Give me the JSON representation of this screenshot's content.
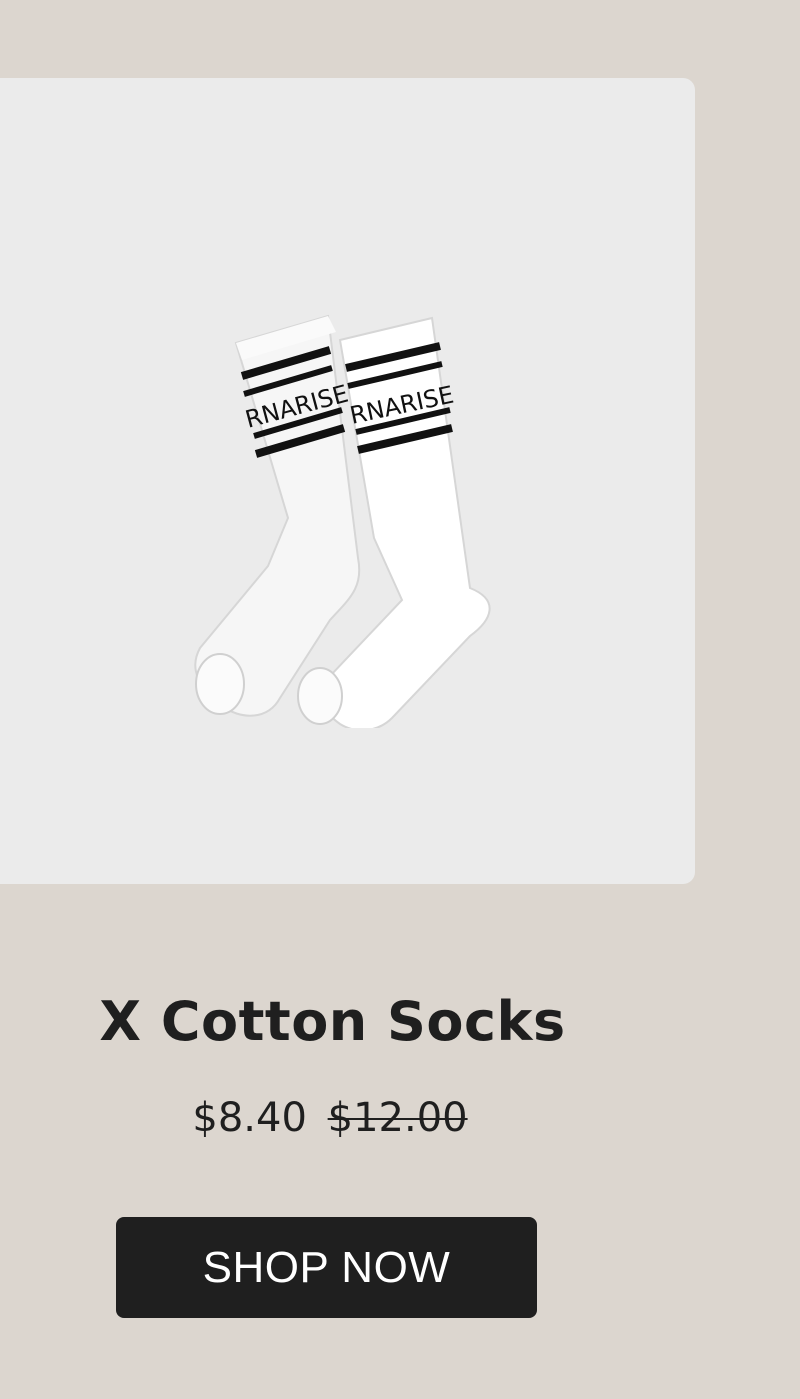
{
  "product": {
    "image_alt": "White crew socks with black stripes",
    "sock_logo_text": "RNARISE",
    "name": "X Cotton Socks",
    "price": "$8.40",
    "old_price": "$12.00",
    "cta_label": "SHOP NOW"
  },
  "colors": {
    "background": "#dcd6cf",
    "card": "#ebebeb",
    "text": "#1f1f1f",
    "button": "#1f1f1f",
    "button_text": "#ffffff"
  }
}
